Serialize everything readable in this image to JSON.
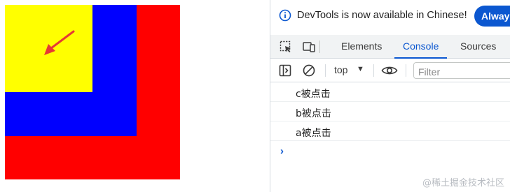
{
  "devtools": {
    "notice": {
      "text": "DevTools is now available in Chinese!",
      "always_button": "Always"
    },
    "tabs": [
      {
        "label": "Elements"
      },
      {
        "label": "Console"
      },
      {
        "label": "Sources"
      }
    ],
    "active_tab": "Console",
    "console_toolbar": {
      "context": "top",
      "filter_placeholder": "Filter"
    },
    "logs": [
      {
        "text": "c被点击"
      },
      {
        "text": "b被点击"
      },
      {
        "text": "a被点击"
      }
    ],
    "prompt_symbol": "›"
  },
  "demo": {
    "colors": {
      "outer": "#ff0000",
      "middle": "#0000ff",
      "inner": "#ffff00",
      "arrow": "#e53935"
    }
  },
  "watermark": "@稀土掘金技术社区",
  "colors": {
    "accent": "#0b57d0"
  }
}
